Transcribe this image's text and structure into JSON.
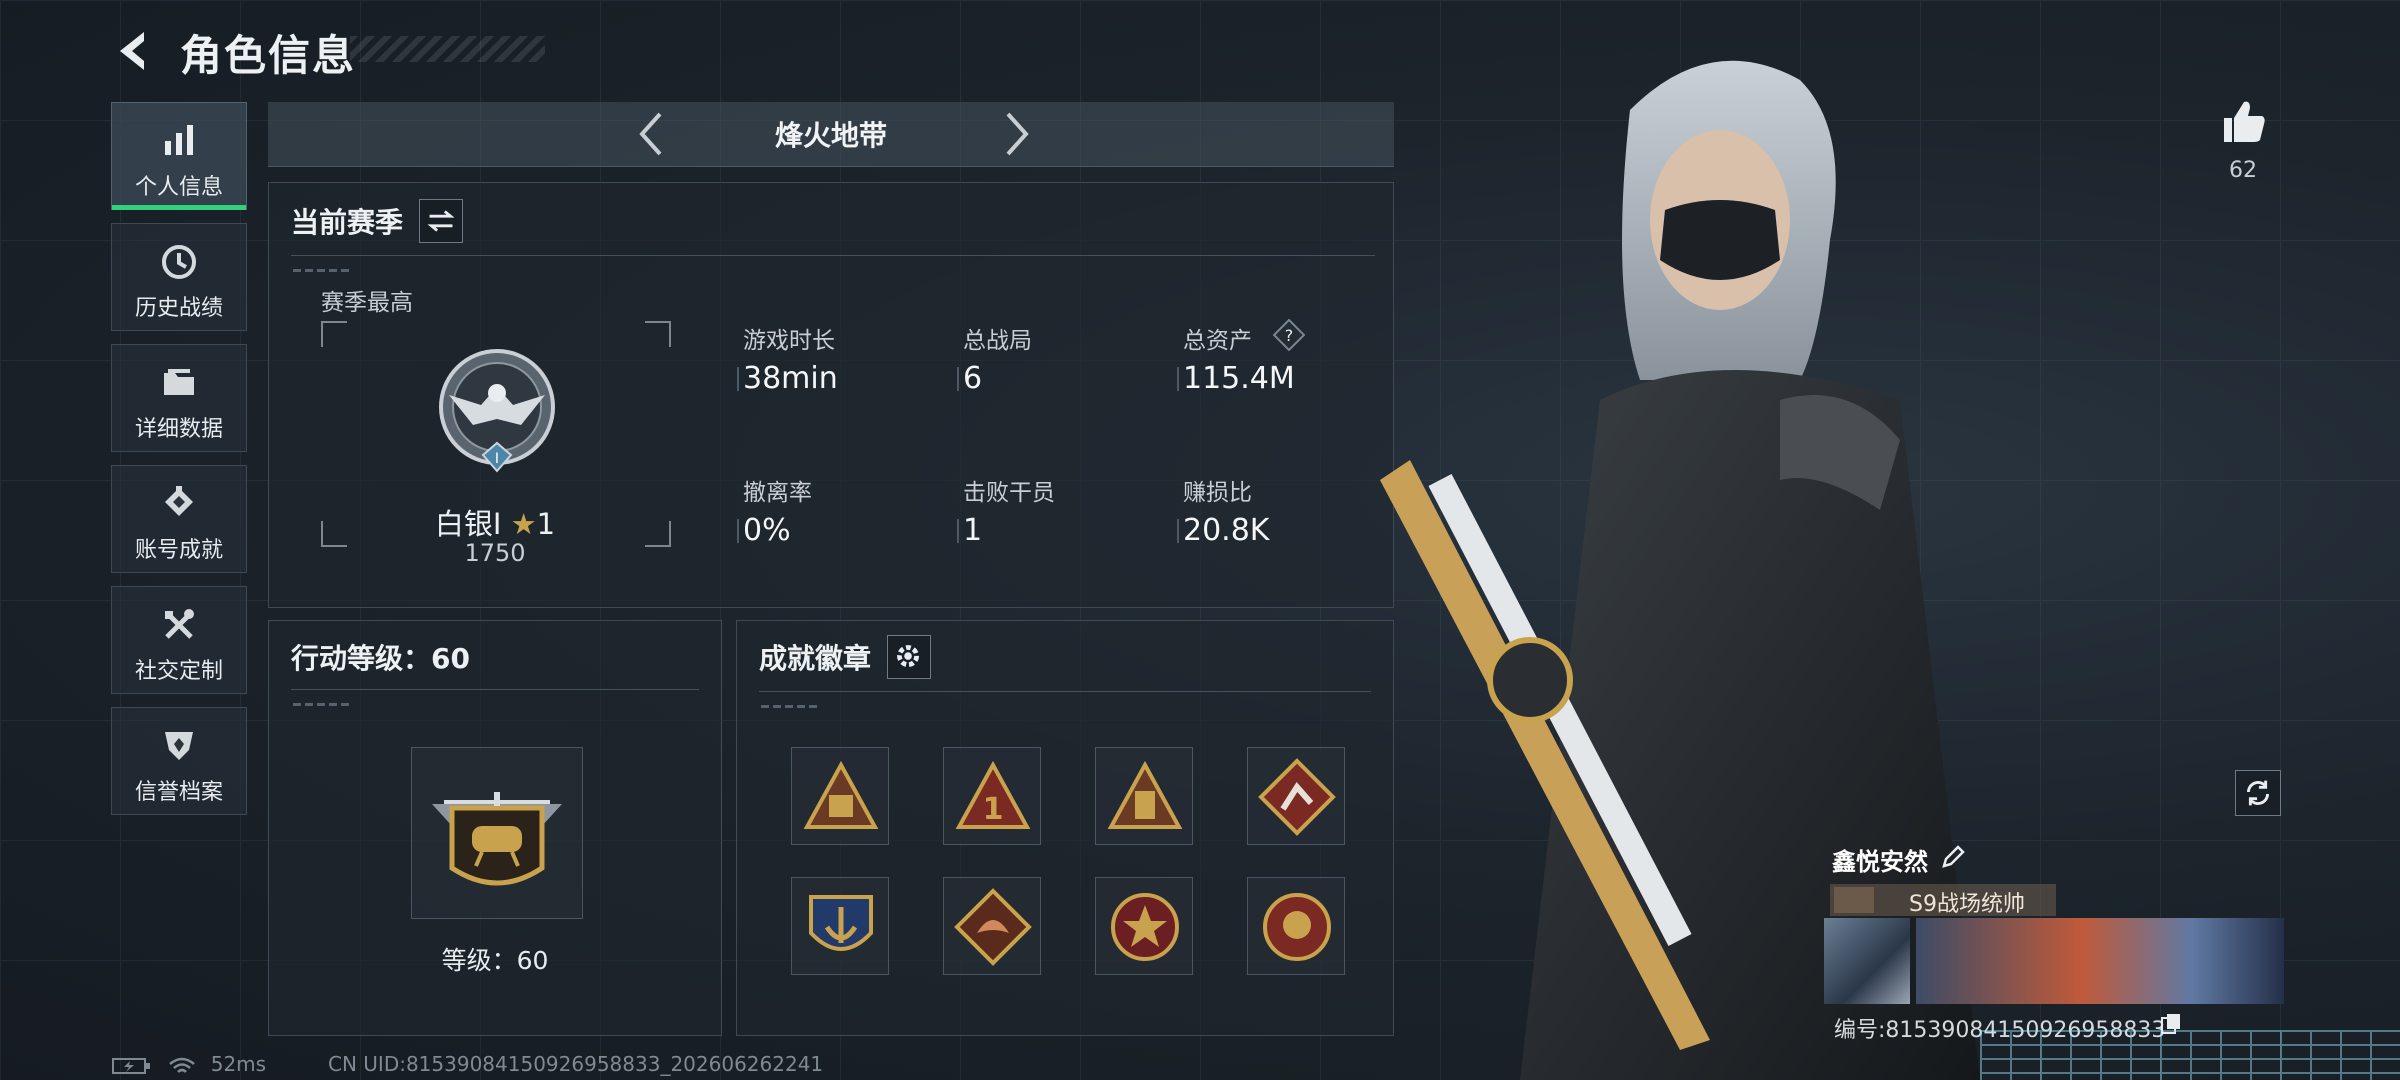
{
  "header": {
    "title": "角色信息"
  },
  "nav": {
    "items": [
      {
        "label": "个人信息",
        "icon": "bar-chart-icon",
        "active": true
      },
      {
        "label": "历史战绩",
        "icon": "history-clock-icon"
      },
      {
        "label": "详细数据",
        "icon": "folder-icon"
      },
      {
        "label": "账号成就",
        "icon": "achievement-icon"
      },
      {
        "label": "社交定制",
        "icon": "tools-icon"
      },
      {
        "label": "信誉档案",
        "icon": "shield-icon"
      }
    ]
  },
  "mode": {
    "name": "烽火地带"
  },
  "season": {
    "title": "当前赛季",
    "best_label": "赛季最高",
    "rank_name": "白银I",
    "rank_stars": "1",
    "rank_score": "1750",
    "stats": [
      {
        "label": "游戏时长",
        "value": "38min"
      },
      {
        "label": "总战局",
        "value": "6"
      },
      {
        "label": "总资产",
        "value": "115.4M"
      },
      {
        "label": "撤离率",
        "value": "0%"
      },
      {
        "label": "击败干员",
        "value": "1"
      },
      {
        "label": "赚损比",
        "value": "20.8K"
      }
    ]
  },
  "level": {
    "title": "行动等级：60",
    "caption": "等级：60"
  },
  "badges": {
    "title": "成就徽章",
    "items": [
      "ammo-badge-icon",
      "rank-one-badge-icon",
      "crate-badge-icon",
      "runner-badge-icon",
      "anchor-badge-icon",
      "dragon-badge-icon",
      "star-badge-icon",
      "emblem-badge-icon"
    ]
  },
  "profile": {
    "likes": "62",
    "name": "鑫悦安然",
    "title": "S9战场统帅",
    "uid_line": "编号:81539084150926958833"
  },
  "status": {
    "ping": "52ms",
    "cn_uid": "CN UID:81539084150926958833_202606262241"
  },
  "colors": {
    "accent": "#2fd27d",
    "gold": "#c9a24d",
    "panel_border": "#3e4b56"
  }
}
